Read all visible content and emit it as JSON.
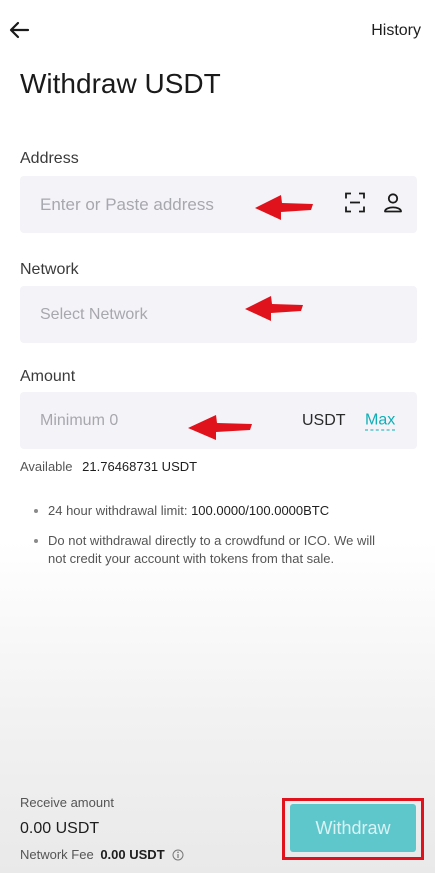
{
  "header": {
    "back_icon": "arrow-left-icon",
    "history_label": "History",
    "title": "Withdraw USDT"
  },
  "address": {
    "label": "Address",
    "placeholder": "Enter or Paste address",
    "scan_icon": "scan-icon",
    "address_book_icon": "person-icon"
  },
  "network": {
    "label": "Network",
    "placeholder": "Select Network"
  },
  "amount": {
    "label": "Amount",
    "placeholder": "Minimum 0",
    "unit": "USDT",
    "max_label": "Max"
  },
  "available": {
    "label": "Available",
    "value": "21.76468731 USDT"
  },
  "notes": {
    "limit_label": "24 hour withdrawal limit:",
    "limit_value": "100.0000/100.0000BTC",
    "warning": "Do not withdrawal directly to a crowdfund or ICO. We will not credit your account with tokens from that sale."
  },
  "footer": {
    "receive_label": "Receive amount",
    "receive_value": "0.00 USDT",
    "fee_label": "Network Fee",
    "fee_value": "0.00 USDT",
    "info_icon": "info-icon",
    "withdraw_label": "Withdraw"
  },
  "colors": {
    "accent": "#11aeb6",
    "button_bg": "#5ec7cc",
    "annotation_red": "#e0121b",
    "field_bg": "#f4f3f8"
  }
}
